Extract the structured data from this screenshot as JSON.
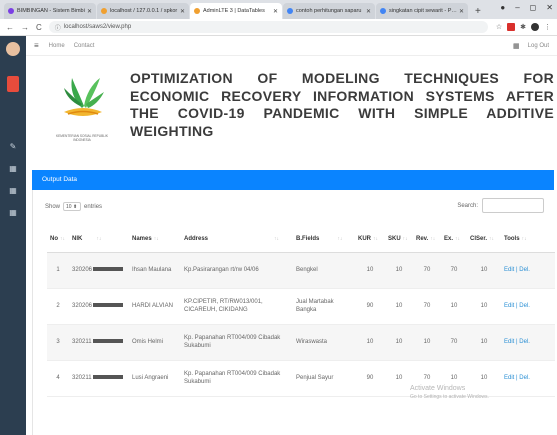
{
  "browser": {
    "tabs": [
      {
        "label": "BIMBINGAN - Sistem Bimbi",
        "color": "#7b3fe4",
        "active": false
      },
      {
        "label": "localhost / 127.0.0.1 / spkor",
        "color": "#f0a030",
        "active": false
      },
      {
        "label": "AdminLTE 3 | DataTables",
        "color": "#f0a030",
        "active": true
      },
      {
        "label": "contoh perhitungan saparu",
        "color": "#4285f4",
        "active": false
      },
      {
        "label": "singkatan cipit sewarit - Pen",
        "color": "#4285f4",
        "active": false
      }
    ],
    "new_tab": "+",
    "url": "localhost/saws2/view.php"
  },
  "topnav": {
    "home": "Home",
    "contact": "Contact",
    "logout": "Log Out"
  },
  "header": {
    "title": "OPTIMIZATION OF MODELING TECHNIQUES FOR ECONOMIC RECOVERY INFORMATION SYSTEMS AFTER THE COVID-19 PANDEMIC WITH SIMPLE ADDITIVE WEIGHTING",
    "logo_caption": "KEMENTERIAN SOSIAL REPUBLIK INDONESIA"
  },
  "panel": {
    "title": "Output Data",
    "show_label": "Show",
    "show_value": "10",
    "entries_label": "entries",
    "search_label": "Search:"
  },
  "table": {
    "columns": [
      "No",
      "NIK",
      "Names",
      "Address",
      "B.Fields",
      "KUR",
      "SKU",
      "Rev.",
      "Ex.",
      "ClSer.",
      "Tools"
    ],
    "rows": [
      {
        "no": "1",
        "nik": "320206",
        "name": "Ihsan Maulana",
        "address": "Kp.Pasirarangan rt/rw 04/06",
        "field": "Bengkel",
        "kur": "10",
        "sku": "10",
        "rev": "70",
        "ex": "70",
        "clser": "10",
        "tools": "Edit | Del."
      },
      {
        "no": "2",
        "nik": "320206",
        "name": "HARDI ALVIAN",
        "address": "KP.CIPETIR, RT/RW013/001, CICAREUH, CIKIDANG",
        "field": "Jual Martabak Bangka",
        "kur": "90",
        "sku": "10",
        "rev": "70",
        "ex": "10",
        "clser": "10",
        "tools": "Edit | Del."
      },
      {
        "no": "3",
        "nik": "320211",
        "name": "Omis Helmi",
        "address": "Kp. Papanahan RT004/009 Cibadak Sukabumi",
        "field": "Wiraswasta",
        "kur": "10",
        "sku": "10",
        "rev": "10",
        "ex": "70",
        "clser": "10",
        "tools": "Edit | Del."
      },
      {
        "no": "4",
        "nik": "320211",
        "name": "Lusi Angraeni",
        "address": "Kp. Papanahan RT004/009 Cibadak Sukabumi",
        "field": "Penjual Sayur",
        "kur": "90",
        "sku": "10",
        "rev": "70",
        "ex": "10",
        "clser": "10",
        "tools": "Edit | Del."
      }
    ]
  },
  "watermark": {
    "line1": "Activate Windows",
    "line2": "Go to Settings to activate Windows."
  },
  "colors": {
    "panel_header": "#0a84ff",
    "sidebar": "#2c3e50",
    "link": "#2a8fd4"
  }
}
